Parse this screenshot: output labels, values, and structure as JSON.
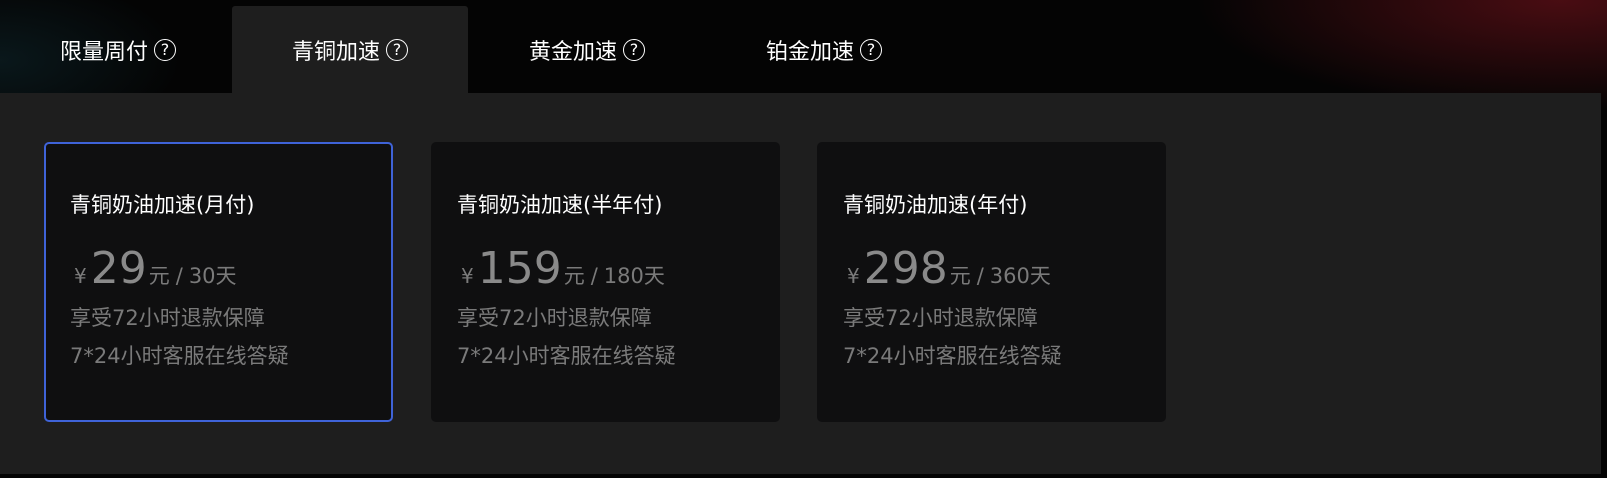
{
  "tabs": [
    {
      "label": "限量周付",
      "help_icon": "?",
      "active": false
    },
    {
      "label": "青铜加速",
      "help_icon": "?",
      "active": true
    },
    {
      "label": "黄金加速",
      "help_icon": "?",
      "active": false
    },
    {
      "label": "铂金加速",
      "help_icon": "?",
      "active": false
    }
  ],
  "plans": [
    {
      "title": "青铜奶油加速(月付)",
      "currency": "¥",
      "price": "29",
      "unit": "元",
      "separator": "/",
      "period": "30天",
      "features": [
        "享受72小时退款保障",
        "7*24小时客服在线答疑"
      ],
      "selected": true
    },
    {
      "title": "青铜奶油加速(半年付)",
      "currency": "¥",
      "price": "159",
      "unit": "元",
      "separator": "/",
      "period": "180天",
      "features": [
        "享受72小时退款保障",
        "7*24小时客服在线答疑"
      ],
      "selected": false
    },
    {
      "title": "青铜奶油加速(年付)",
      "currency": "¥",
      "price": "298",
      "unit": "元",
      "separator": "/",
      "period": "360天",
      "features": [
        "享受72小时退款保障",
        "7*24小时客服在线答疑"
      ],
      "selected": false
    }
  ],
  "colors": {
    "selected_border": "#3f63d8",
    "panel_bg": "#1e1e1e",
    "card_bg": "#0f0f10",
    "muted_text": "#7a7a7a"
  }
}
